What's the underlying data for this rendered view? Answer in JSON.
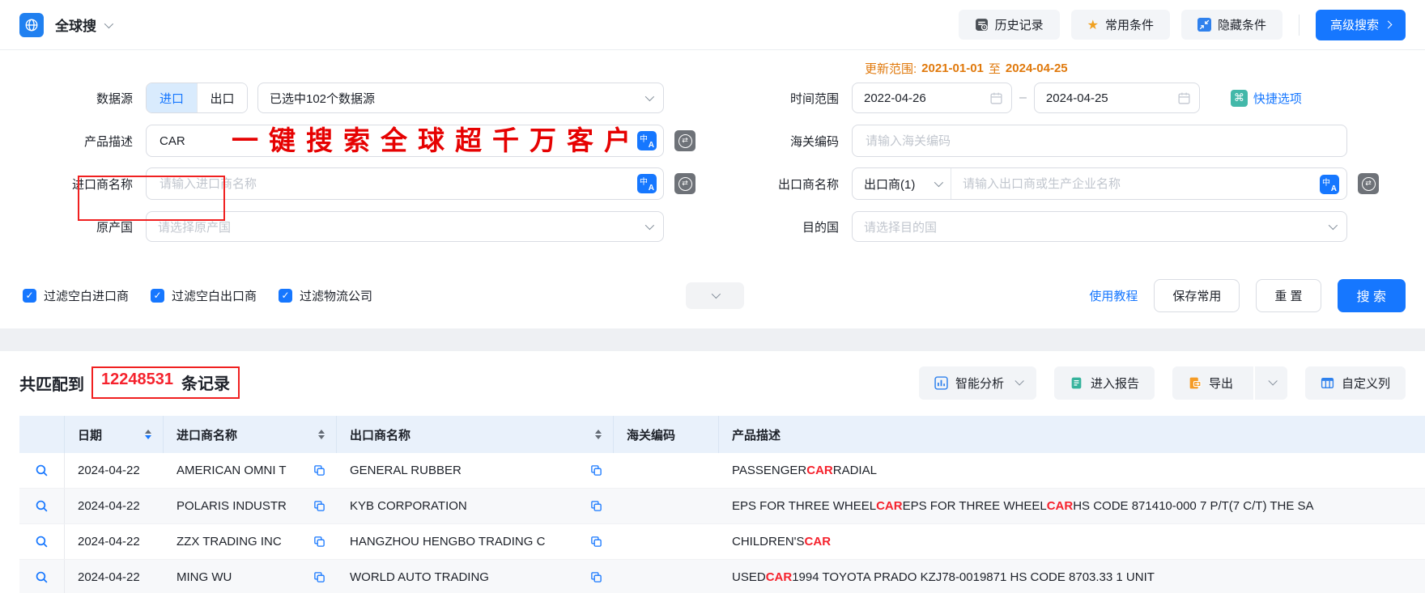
{
  "header": {
    "app_name": "全球搜",
    "history_label": "历史记录",
    "favorites_label": "常用条件",
    "hide_label": "隐藏条件",
    "advanced_label": "高级搜索"
  },
  "form": {
    "update_range": {
      "label": "更新范围:",
      "from": "2021-01-01",
      "to_word": "至",
      "to": "2024-04-25"
    },
    "data_source": {
      "label": "数据源",
      "import_label": "进口",
      "export_label": "出口",
      "selected": "已选中102个数据源"
    },
    "time_range": {
      "label": "时间范围",
      "start": "2022-04-26",
      "end": "2024-04-25",
      "quick_label": "快捷选项"
    },
    "product_desc": {
      "label": "产品描述",
      "value": "CAR",
      "overlay_text": "一键搜索全球超千万客户"
    },
    "hs_code": {
      "label": "海关编码",
      "placeholder": "请输入海关编码"
    },
    "importer": {
      "label": "进口商名称",
      "placeholder": "请输入进口商名称"
    },
    "exporter": {
      "label": "出口商名称",
      "type_selected": "出口商(1)",
      "placeholder": "请输入出口商或生产企业名称"
    },
    "origin": {
      "label": "原产国",
      "placeholder": "请选择原产国"
    },
    "destination": {
      "label": "目的国",
      "placeholder": "请选择目的国"
    },
    "filters": [
      "过滤空白进口商",
      "过滤空白出口商",
      "过滤物流公司"
    ],
    "actions": {
      "tutorial": "使用教程",
      "save": "保存常用",
      "reset": "重 置",
      "search": "搜 索"
    }
  },
  "results": {
    "summary": {
      "prefix": "共匹配到",
      "count": "12248531",
      "suffix": "条记录"
    },
    "toolbar": {
      "analysis": "智能分析",
      "report": "进入报告",
      "export": "导出",
      "columns": "自定义列"
    },
    "table": {
      "columns": [
        "日期",
        "进口商名称",
        "出口商名称",
        "海关编码",
        "产品描述"
      ],
      "sort": {
        "active_column": "日期",
        "direction": "desc"
      },
      "highlight": "CAR",
      "rows": [
        {
          "date": "2024-04-22",
          "importer": "AMERICAN OMNI T",
          "exporter": "GENERAL RUBBER",
          "hs_code": "",
          "description": "PASSENGER CAR RADIAL"
        },
        {
          "date": "2024-04-22",
          "importer": "POLARIS INDUSTR",
          "exporter": "KYB CORPORATION",
          "hs_code": "",
          "description": "EPS FOR THREE WHEEL CAR EPS FOR THREE WHEEL CAR HS CODE 871410-000 7 P/T(7 C/T) THE SA"
        },
        {
          "date": "2024-04-22",
          "importer": "ZZX TRADING INC",
          "exporter": "HANGZHOU HENGBO TRADING C",
          "hs_code": "",
          "description": "CHILDREN'S CAR"
        },
        {
          "date": "2024-04-22",
          "importer": "MING WU",
          "exporter": "WORLD AUTO TRADING",
          "hs_code": "",
          "description": "USED CAR 1994 TOYOTA PRADO KZJ78-0019871 HS CODE 8703.33 1 UNIT"
        }
      ]
    }
  },
  "icons": {
    "star": "★",
    "command": "⌘",
    "swap": "⇄",
    "check": "✓",
    "dash": "–"
  },
  "colors": {
    "accent_blue": "#1677ff",
    "annotation_red": "#f02020",
    "highlight_red": "#f5222d",
    "update_orange": "#e0790c",
    "quick_teal": "#43b8a9",
    "table_header_blue": "#e9f1fb"
  }
}
